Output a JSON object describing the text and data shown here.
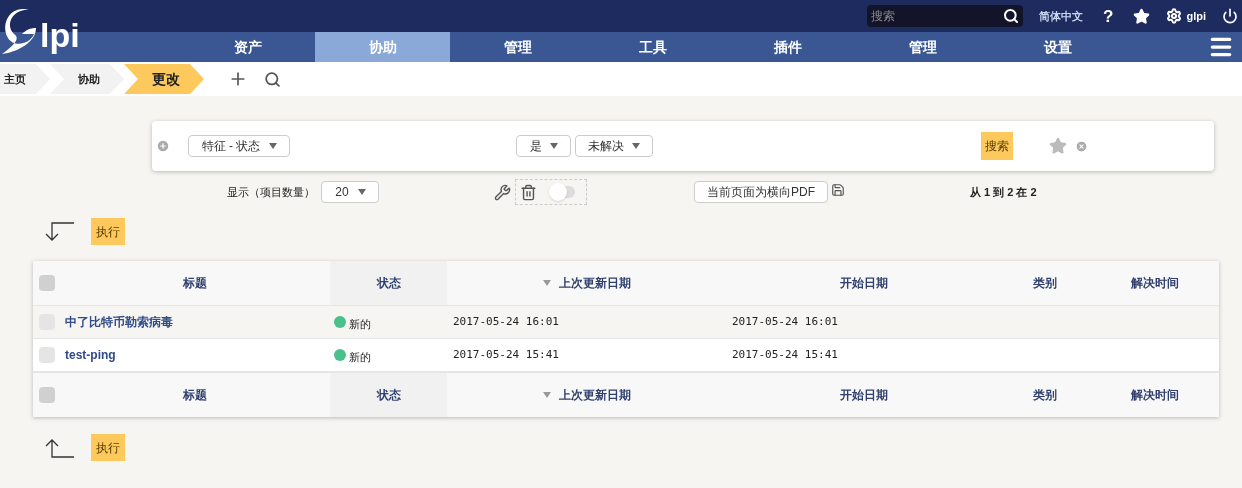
{
  "header": {
    "logo_text": "lpi",
    "search": {
      "placeholder": "搜索"
    },
    "language": "简体中文",
    "help": "?",
    "user": "glpi"
  },
  "nav": [
    {
      "label": "资产",
      "selected": false
    },
    {
      "label": "协助",
      "selected": true
    },
    {
      "label": "管理",
      "selected": false
    },
    {
      "label": "工具",
      "selected": false
    },
    {
      "label": "插件",
      "selected": false
    },
    {
      "label": "管理",
      "selected": false
    },
    {
      "label": "设置",
      "selected": false
    }
  ],
  "breadcrumb": [
    {
      "label": "主页",
      "selected": false
    },
    {
      "label": "协助",
      "selected": false
    },
    {
      "label": "更改",
      "selected": true
    }
  ],
  "criteria": {
    "field": "特征 - 状态",
    "operator": "是",
    "value": "未解决",
    "search_button": "搜索"
  },
  "display": {
    "label": "显示（项目数量）",
    "count": "20",
    "export": "当前页面为横向PDF",
    "pagination": "从 1 到 2 在 2",
    "massive_toggle_on": false
  },
  "action_button": "执行",
  "table": {
    "select_all_checked": false,
    "columns": [
      {
        "label": "标题",
        "sorted": false
      },
      {
        "label": "状态",
        "sorted": false
      },
      {
        "label": "上次更新日期",
        "sorted": true
      },
      {
        "label": "开始日期",
        "sorted": false
      },
      {
        "label": "类别",
        "sorted": false
      },
      {
        "label": "解决时间",
        "sorted": false
      }
    ],
    "rows": [
      {
        "checked": false,
        "title": "中了比特币勒索病毒",
        "status": "新的",
        "color": "#4ac08a",
        "updated": "2017-05-24 16:01",
        "started": "2017-05-24 16:01"
      },
      {
        "checked": false,
        "title": "test-ping",
        "status": "新的",
        "color": "#4ac08a",
        "updated": "2017-05-24 15:41",
        "started": "2017-05-24 15:41"
      }
    ],
    "footer_select_all_checked": false,
    "footer_columns": [
      {
        "label": "标题",
        "sorted": false
      },
      {
        "label": "状态",
        "sorted": false
      },
      {
        "label": "上次更新日期",
        "sorted": true
      },
      {
        "label": "开始日期",
        "sorted": false
      },
      {
        "label": "类别",
        "sorted": false
      },
      {
        "label": "解决时间",
        "sorted": false
      }
    ]
  },
  "bottom_action_button": "执行"
}
